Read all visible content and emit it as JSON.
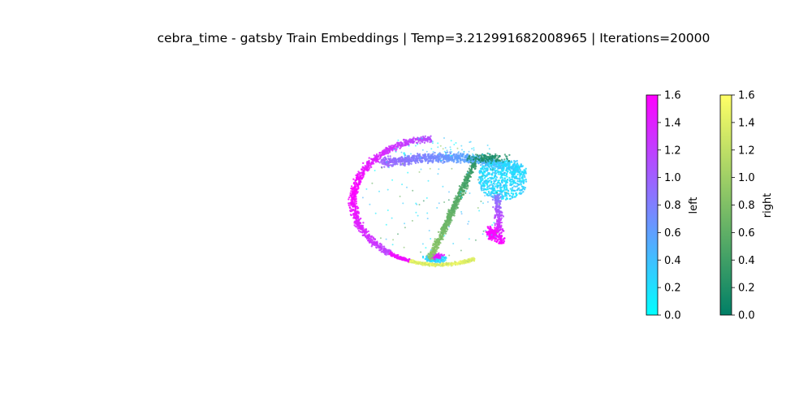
{
  "chart_data": {
    "type": "scatter",
    "title": "cebra_time - gatsby Train Embeddings | Temp=3.212991682008965 | Iterations=20000",
    "axes_visible": false,
    "projection": "3d",
    "colorbars": [
      {
        "label": "left",
        "colormap": "cool",
        "range": [
          0.0,
          1.6
        ],
        "ticks": [
          "0.0",
          "0.2",
          "0.4",
          "0.6",
          "0.8",
          "1.0",
          "1.2",
          "1.4",
          "1.6"
        ],
        "colors": [
          "#00ffff",
          "#ff00ff"
        ]
      },
      {
        "label": "right",
        "colormap": "summer",
        "range": [
          0.0,
          1.6
        ],
        "ticks": [
          "0.0",
          "0.2",
          "0.4",
          "0.6",
          "0.8",
          "1.0",
          "1.2",
          "1.4",
          "1.6"
        ],
        "colors": [
          "#007f66",
          "#ffff66"
        ]
      }
    ],
    "series": [
      {
        "name": "left",
        "colormap": "cool",
        "segments": [
          {
            "value_range": [
              0.0,
              0.4
            ],
            "region": "bottom-center"
          },
          {
            "value_range": [
              0.3,
              0.8
            ],
            "region": "lower-right lobe"
          },
          {
            "value_range": [
              0.5,
              1.0
            ],
            "region": "top arc"
          },
          {
            "value_range": [
              1.0,
              1.6
            ],
            "region": "left arc"
          },
          {
            "value_range": [
              1.4,
              1.6
            ],
            "region": "lower-right cluster"
          }
        ]
      },
      {
        "name": "right",
        "colormap": "summer",
        "segments": [
          {
            "value_range": [
              0.0,
              0.3
            ],
            "region": "top-right"
          },
          {
            "value_range": [
              0.3,
              0.8
            ],
            "region": "diagonal stem"
          },
          {
            "value_range": [
              0.9,
              1.6
            ],
            "region": "bottom arc"
          }
        ]
      }
    ]
  }
}
